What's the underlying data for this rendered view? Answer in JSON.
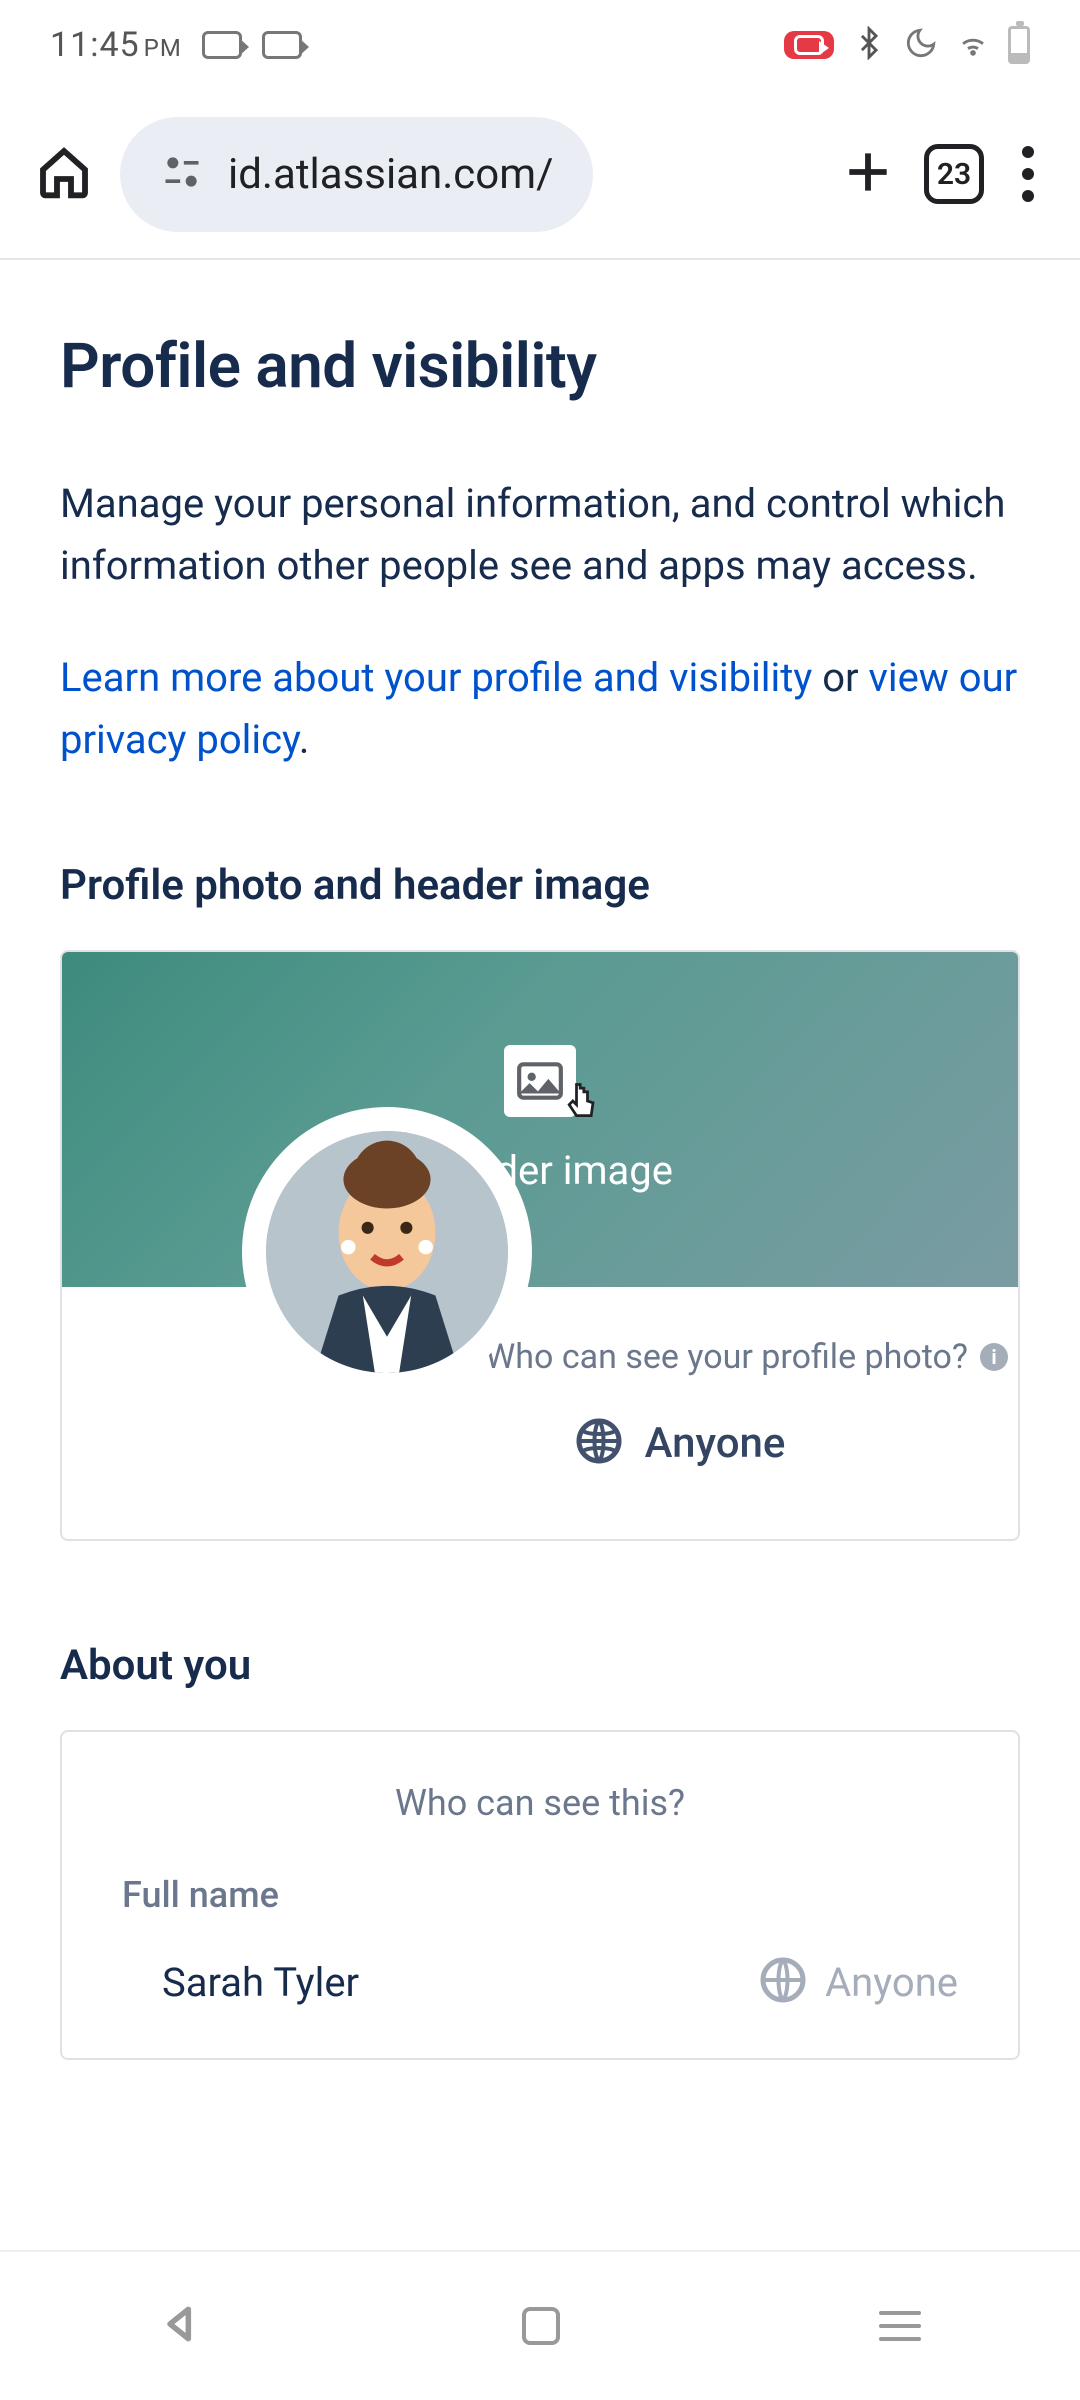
{
  "status": {
    "time": "11:45",
    "period": "PM"
  },
  "browser": {
    "url": "id.atlassian.com/",
    "tab_count": "23"
  },
  "page": {
    "title": "Profile and visibility",
    "intro": "Manage your personal information, and control which information other people see and apps may access.",
    "learn_link": "Learn more about your profile and visibility",
    "or_text": " or ",
    "privacy_link": "view our privacy policy",
    "period": "."
  },
  "photo_section": {
    "title": "Profile photo and header image",
    "header_text": "r header image",
    "who_label": "Who can see your profile photo?",
    "visibility": "Anyone"
  },
  "about_section": {
    "title": "About you",
    "header": "Who can see this?",
    "full_name_label": "Full name",
    "full_name_value": "Sarah Tyler",
    "full_name_visibility": "Anyone"
  }
}
